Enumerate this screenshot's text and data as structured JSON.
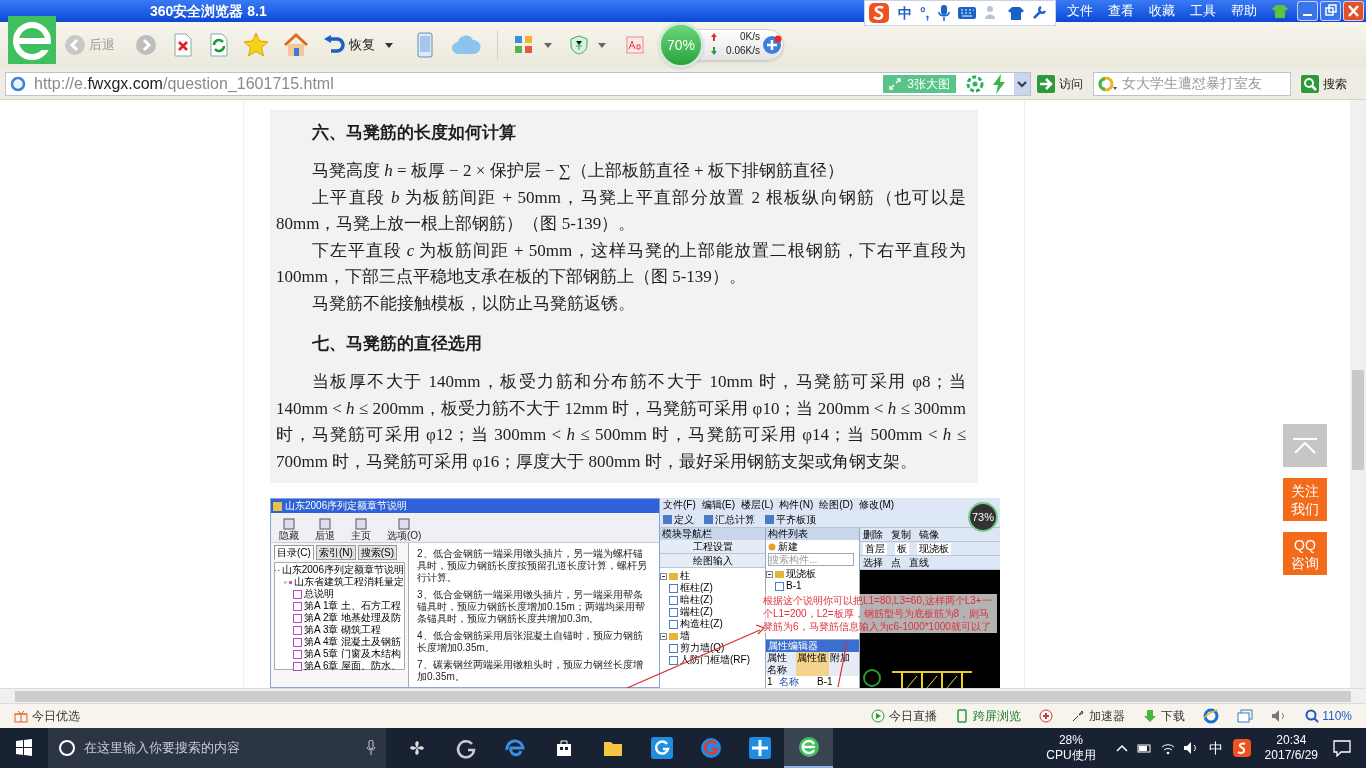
{
  "title_bar": {
    "title": "360安全浏览器 8.1",
    "menu": [
      "文件",
      "查看",
      "收藏",
      "工具",
      "帮助"
    ]
  },
  "ime_bar": {
    "items": [
      "中",
      "°,"
    ]
  },
  "toolbar": {
    "back": "后退",
    "restore": "恢复",
    "speed": {
      "percent": "70%",
      "up": "0K/s",
      "down": "0.06K/s"
    }
  },
  "address_bar": {
    "url_parts": [
      "http://e.",
      "fwxgx.com",
      "/question_1601715.html"
    ],
    "image_button": "3张大图",
    "go_button": "访问",
    "search": {
      "placeholder": "女大学生遭怼暴打室友"
    },
    "search_button": "搜索"
  },
  "article": {
    "blocks": [
      {
        "kind": "heading",
        "text": "六、马凳筋的长度如何计算"
      },
      {
        "kind": "para",
        "text": "马凳高度 *h* = 板厚 − 2 × 保护层 − ∑（上部板筋直径 + 板下排钢筋直径）"
      },
      {
        "kind": "para",
        "text": "上平直段 *b* 为板筋间距 + 50mm，马凳上平直部分放置 2 根板纵向钢筋（也可以是 80mm，马凳上放一根上部钢筋）（图 5-139）。"
      },
      {
        "kind": "para",
        "text": "下左平直段 *c* 为板筋间距 + 50mm，这样马凳的上部能放置二根钢筋，下右平直段为 100mm，下部三点平稳地支承在板的下部钢筋上（图 5-139）。"
      },
      {
        "kind": "para",
        "text": "马凳筋不能接触模板，以防止马凳筋返锈。"
      },
      {
        "kind": "heading",
        "text": "七、马凳筋的直径选用"
      },
      {
        "kind": "para",
        "text": "当板厚不大于 140mm，板受力筋和分布筋不大于 10mm 时，马凳筋可采用 φ8；当 140mm < *h* ≤ 200mm，板受力筋不大于 12mm 时，马凳筋可采用 φ10；当 200mm < *h* ≤ 300mm 时，马凳筋可采用 φ12；当 300mm < *h* ≤ 500mm 时，马凳筋可采用 φ14；当 500mm < *h* ≤ 700mm 时，马凳筋可采用 φ16；厚度大于 800mm 时，最好采用钢筋支架或角钢支架。"
      }
    ]
  },
  "embedded_screenshot": {
    "help_window": {
      "title": "山东2006序列定额章节说明",
      "toolbar": [
        "隐藏",
        "后退",
        "主页",
        "选项(O)"
      ],
      "tabs": [
        {
          "label": "目录(C)",
          "selected": true
        },
        {
          "label": "索引(N)",
          "selected": false
        },
        {
          "label": "搜索(S)",
          "selected": false
        }
      ],
      "tree": [
        {
          "label": "山东2006序列定额章节说明",
          "children": [
            {
              "label": "山东省建筑工程消耗量定",
              "children": [
                {
                  "label": "总说明"
                },
                {
                  "label": "第A 1章 土、石方工程"
                },
                {
                  "label": "第A 2章 地基处理及防"
                },
                {
                  "label": "第A 3章 砌筑工程"
                },
                {
                  "label": "第A 4章 混凝土及钢筋"
                },
                {
                  "label": "第A 5章 门窗及木结构"
                },
                {
                  "label": "第A 6章 屋面、防水、"
                }
              ]
            }
          ]
        }
      ],
      "paragraphs": [
        "2、低合金钢筋一端采用镦头插片，另一端为螺杆锚具时，预应力钢筋长度按预留孔道长度计算，螺杆另行计算。",
        "3、低合金钢筋一端采用镦头插片，另一端采用帮条锚具时，预应力钢筋长度增加0.15m；两端均采用帮条锚具时，预应力钢筋长度共增加0.3m。",
        "4、低合金钢筋采用后张混凝土自锚时，预应力钢筋长度增加0.35m。",
        "7、碳素钢丝两端采用镦粗头时，预应力钢丝长度增加0.35m。"
      ]
    },
    "app_window": {
      "menu": [
        "文件(F)",
        "编辑(E)",
        "楼层(L)",
        "构件(N)",
        "绘图(D)",
        "修改(M)"
      ],
      "tools": [
        "定义",
        "汇总计算",
        "平齐板顶"
      ],
      "badge": "73%",
      "nav_title": "模块导航栏",
      "nav_buttons": [
        "工程设置",
        "绘图输入"
      ],
      "nav_tree": [
        {
          "label": "柱",
          "children": [
            {
              "label": "框柱(Z)"
            },
            {
              "label": "暗柱(Z)"
            },
            {
              "label": "端柱(Z)"
            },
            {
              "label": "构造柱(Z)"
            }
          ]
        },
        {
          "label": "墙",
          "children": [
            {
              "label": "剪力墙(Q)"
            },
            {
              "label": "人防门框墙(RF)"
            }
          ]
        }
      ],
      "list_title": "构件列表",
      "new_button": "新建",
      "list_search": {
        "placeholder": "搜索构件..."
      },
      "list_tree": [
        {
          "label": "现浇板",
          "children": [
            {
              "label": "B-1"
            }
          ]
        }
      ],
      "props_title": "属性编辑器",
      "props_columns": [
        "属性名称",
        "属性值",
        "附加"
      ],
      "props_rows": [
        [
          "1",
          "名称",
          "B-1"
        ]
      ],
      "edit_tools": [
        "删除",
        "复制",
        "镜像"
      ],
      "layer_row": [
        "首层",
        "板",
        "现浇板"
      ],
      "draw_tools": [
        "选择",
        "点",
        "直线"
      ]
    },
    "annotation": "根据这个说明你可以把L1=80,L3=60,这样两个L3+一个L1=200，L2=板厚，钢筋型号为底板筋为8，则马凳筋为6，马凳筋信息输入为c6-1000*1000就可以了"
  },
  "side_buttons": [
    {
      "kind": "top"
    },
    {
      "kind": "text",
      "text": "关注我们"
    },
    {
      "kind": "text",
      "text": "QQ咨询"
    }
  ],
  "status_bar": {
    "left": "今日优选",
    "items": [
      "今日直播",
      "跨屏浏览",
      "加速器",
      "下载"
    ],
    "zoom": "110%"
  },
  "taskbar": {
    "search": {
      "placeholder": "在这里输入你要搜索的内容"
    },
    "cpu": {
      "value": "28%",
      "label": "CPU使用"
    },
    "ime": "中",
    "time": "20:34",
    "date": "2017/6/29"
  }
}
